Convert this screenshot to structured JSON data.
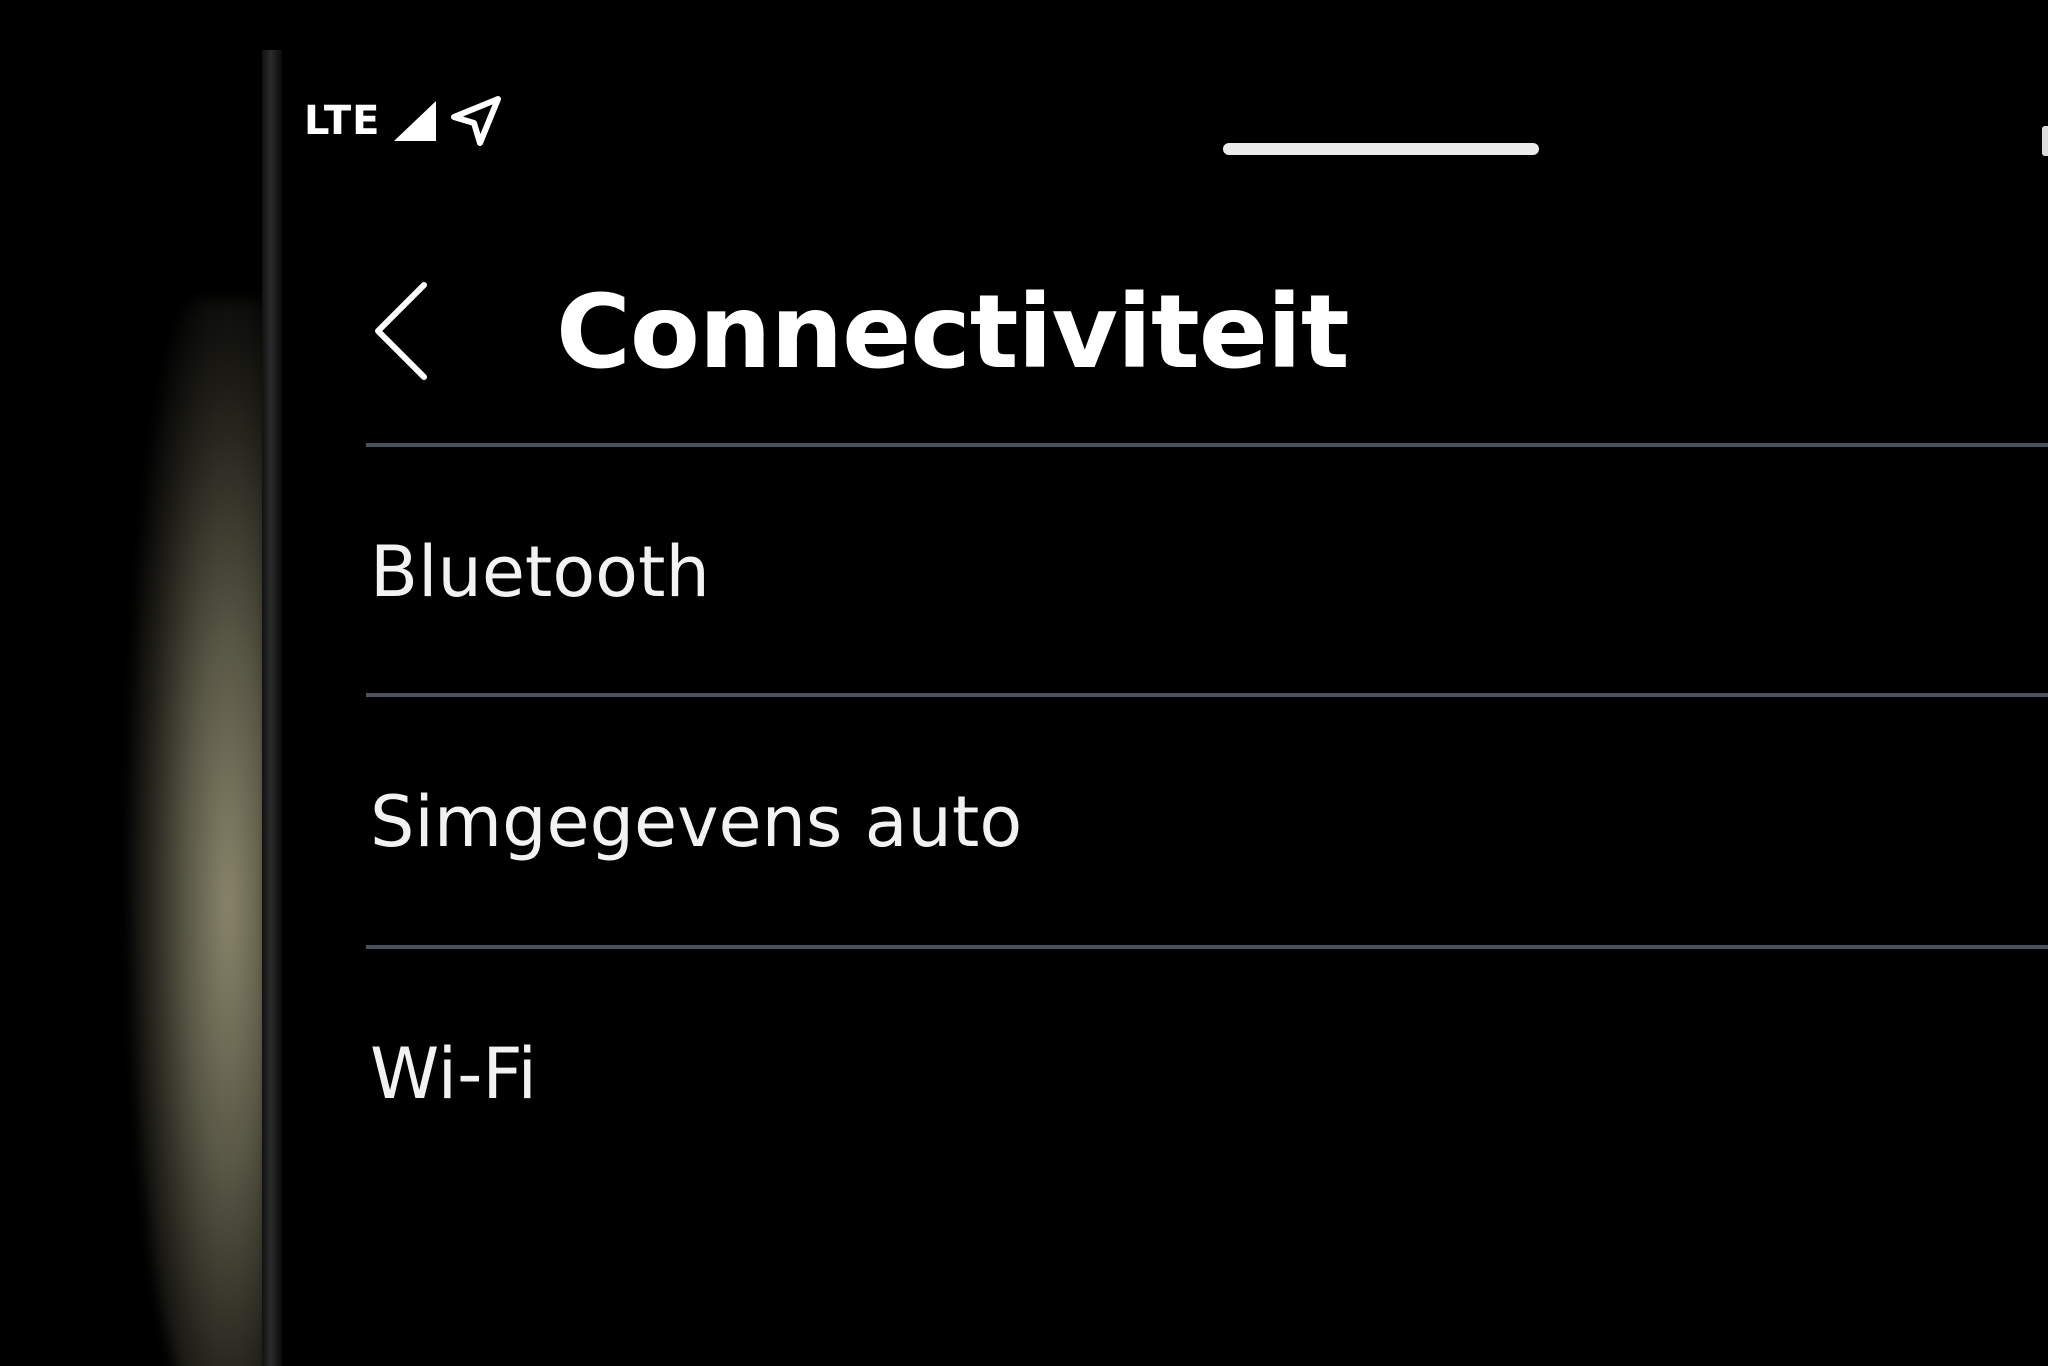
{
  "status_bar": {
    "network": "LTE",
    "icons": [
      "signal-icon",
      "navigation-arrow-icon"
    ]
  },
  "header": {
    "title": "Connectiviteit",
    "back_icon": "chevron-left-icon"
  },
  "menu": {
    "items": [
      {
        "label": "Bluetooth"
      },
      {
        "label": "Simgegevens auto"
      },
      {
        "label": "Wi-Fi"
      }
    ]
  },
  "colors": {
    "background": "#000000",
    "text": "#FFFFFF",
    "divider": "#4A5260"
  }
}
